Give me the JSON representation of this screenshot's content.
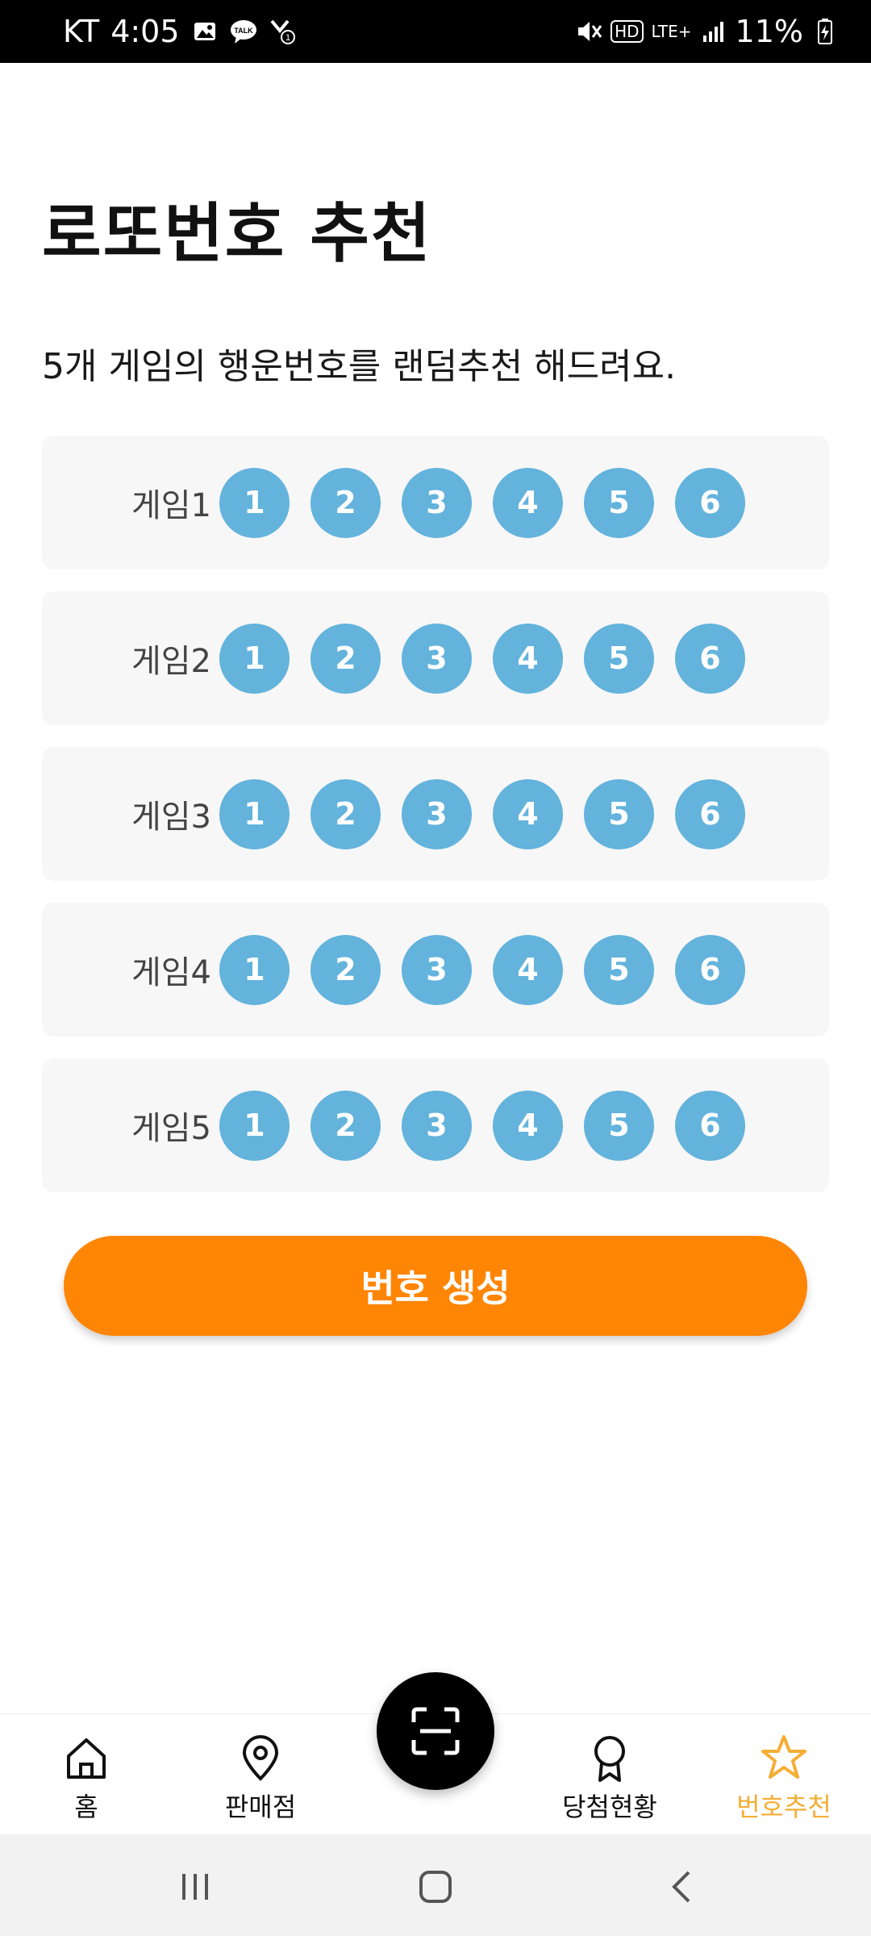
{
  "status_bar": {
    "carrier": "KT",
    "time": "4:05",
    "battery": "11%",
    "left_icons": [
      "image-icon",
      "kakaotalk-icon",
      "missed-call-icon"
    ],
    "right_icons": [
      "mute-icon",
      "hd-icon",
      "lte-icon",
      "signal-icon",
      "battery-charging-icon"
    ],
    "hd_label": "HD",
    "lte_label": "LTE+",
    "talk_label": "TALK"
  },
  "page": {
    "title": "로또번호 추천",
    "subtitle": "5개 게임의 행운번호를 랜덤추천 해드려요."
  },
  "games": [
    {
      "label": "게임1",
      "numbers": [
        "1",
        "2",
        "3",
        "4",
        "5",
        "6"
      ]
    },
    {
      "label": "게임2",
      "numbers": [
        "1",
        "2",
        "3",
        "4",
        "5",
        "6"
      ]
    },
    {
      "label": "게임3",
      "numbers": [
        "1",
        "2",
        "3",
        "4",
        "5",
        "6"
      ]
    },
    {
      "label": "게임4",
      "numbers": [
        "1",
        "2",
        "3",
        "4",
        "5",
        "6"
      ]
    },
    {
      "label": "게임5",
      "numbers": [
        "1",
        "2",
        "3",
        "4",
        "5",
        "6"
      ]
    }
  ],
  "generate_button": {
    "label": "번호 생성"
  },
  "bottom_nav": {
    "items": [
      {
        "label": "홈",
        "icon": "home-icon"
      },
      {
        "label": "판매점",
        "icon": "location-pin-icon"
      },
      {
        "label": "당첨현황",
        "icon": "award-ribbon-icon"
      },
      {
        "label": "번호추천",
        "icon": "star-icon",
        "active": true
      }
    ],
    "center_button_icon": "scan-icon"
  },
  "colors": {
    "ball": "#63b3dc",
    "accent_button": "#ff8505",
    "active_nav": "#f5ad35"
  }
}
